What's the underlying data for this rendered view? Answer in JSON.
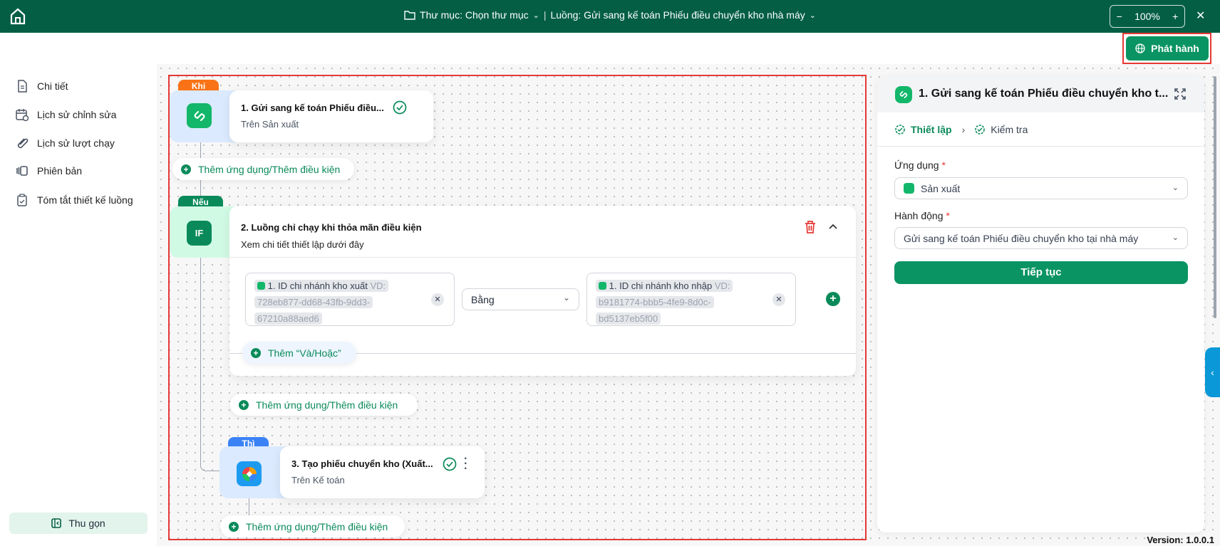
{
  "topbar": {
    "folder_label": "Thư mục: Chọn thư mục",
    "flow_label": "Luồng: Gửi sang kế toán Phiếu điều chuyển kho nhà máy",
    "zoom": "100%",
    "minus": "−",
    "plus": "+",
    "close": "✕"
  },
  "publish": {
    "label": "Phát hành"
  },
  "sidebar": {
    "items": [
      {
        "label": "Chi tiết"
      },
      {
        "label": "Lịch sử chỉnh sửa"
      },
      {
        "label": "Lịch sử lượt chạy"
      },
      {
        "label": "Phiên bản"
      },
      {
        "label": "Tóm tắt thiết kế luồng"
      }
    ],
    "collapse": "Thu gọn"
  },
  "flow": {
    "add_label": "Thêm ứng dụng/Thêm điều kiện",
    "node1": {
      "badge": "Khi",
      "title": "1.  Gửi sang kế toán Phiếu điều...",
      "subtitle": "Trên Sản xuất"
    },
    "node2": {
      "badge": "Nếu",
      "icon_text": "IF",
      "title": "2. Luồng chỉ chạy khi thỏa mãn điều kiện",
      "subtitle": "Xem chi tiết thiết lập dưới đây",
      "left_field": {
        "chip": "1. ID chi nhánh kho xuất",
        "hint": "VD:",
        "value1": "728eb877-dd68-43fb-9dd3-",
        "value2": "67210a88aed6"
      },
      "operator": "Bằng",
      "right_field": {
        "chip": "1. ID chi nhánh kho nhập",
        "hint": "VD:",
        "value1": "b9181774-bbb5-4fe9-8d0c-",
        "value2": "bd5137eb5f00"
      },
      "add_andor": "Thêm “Và/Hoặc”"
    },
    "node3": {
      "badge": "Thì",
      "title": "3.  Tạo phiếu chuyển kho (Xuất...",
      "subtitle": "Trên Kế toán"
    }
  },
  "panel": {
    "title": "1. Gửi sang kế toán Phiếu điều chuyển kho t...",
    "step1": "Thiết lập",
    "step2": "Kiểm tra",
    "app_label": "Ứng dụng",
    "app_value": "Sản xuất",
    "action_label": "Hành động",
    "action_value": "Gửi sang kế toán Phiếu điều chuyển kho tại nhà máy",
    "continue": "Tiếp tục",
    "required": "*"
  },
  "version": "Version: 1.0.0.1",
  "colors": {
    "brand": "#035e44",
    "green": "#0a8a5a",
    "khi": "#f97316",
    "thi": "#3b82f6",
    "highlight": "#e53935"
  }
}
